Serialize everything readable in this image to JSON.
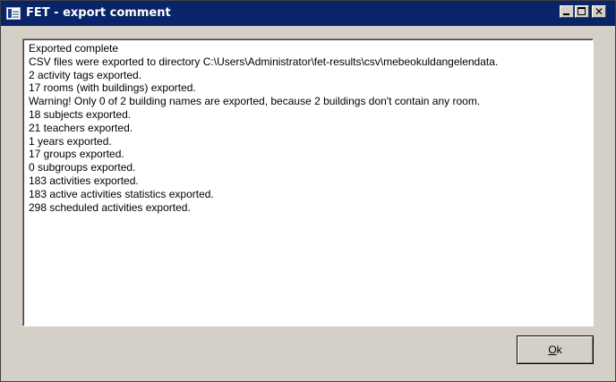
{
  "window": {
    "title": "FET - export comment",
    "icon": "fet-app-icon",
    "controls": {
      "minimize_icon": "minimize-icon",
      "maximize_icon": "maximize-icon",
      "close_icon": "close-icon",
      "close_glyph": "✕"
    }
  },
  "log_lines": [
    "Exported complete",
    "CSV files were exported to directory C:\\Users\\Administrator\\fet-results\\csv\\mebeokuldangelendata.",
    "2 activity tags exported.",
    "17 rooms (with buildings) exported.",
    "Warning! Only 0 of 2 building names are exported, because 2 buildings don't contain any room.",
    "18 subjects exported.",
    "21 teachers exported.",
    "1 years exported.",
    "17 groups exported.",
    "0 subgroups exported.",
    "183 activities exported.",
    "183 active activities statistics exported.",
    "298 scheduled activities exported."
  ],
  "buttons": {
    "ok": {
      "mnemonic": "O",
      "rest": "k"
    }
  },
  "colors": {
    "titlebar": "#0a246a",
    "window_face": "#d4d0c8",
    "text_area": "#ffffff"
  }
}
